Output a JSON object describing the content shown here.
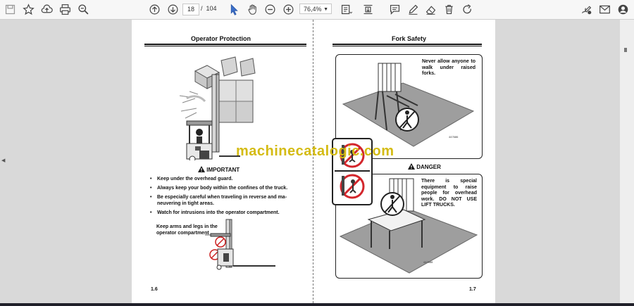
{
  "toolbar": {
    "page_current": "18",
    "page_separator": "/",
    "page_total": "104",
    "zoom_value": "76,4%",
    "icons_left": [
      "save-icon",
      "bookmark-icon",
      "upload-icon",
      "print-icon",
      "zoom-search-icon"
    ],
    "icons_mid": [
      "page-up-icon",
      "page-down-icon",
      "select-arrow-icon",
      "hand-icon",
      "zoom-out-icon",
      "zoom-in-icon"
    ],
    "icons_right": [
      "page-fit-icon",
      "scroll-icon",
      "comment-icon",
      "pen-icon",
      "eraser-icon",
      "trash-icon",
      "rotate-icon",
      "sign-icon",
      "mail-icon",
      "account-icon"
    ]
  },
  "left_page": {
    "header": "Operator Protection",
    "important_label": "IMPORTANT",
    "bullets": [
      "Keep under the overhead guard.",
      "Always keep your body within the confines of the truck.",
      "Be especially careful when traveling in reverse and ma-neuvering in tight areas.",
      "Watch for intrusions into the operator compartment."
    ],
    "caption": "Keep arms and legs in the operator compartment",
    "page_number": "1.6"
  },
  "right_page": {
    "header": "Fork Safety",
    "box1_text": "Never allow anyone to walk under raised forks.",
    "danger_label": "DANGER",
    "box2_text": "There is special equipment to raise people for overhead work. DO NOT USE LIFT TRUCKS.",
    "page_number": "1.7"
  },
  "watermark": "machinecatalogic.com",
  "colors": {
    "toolbar_bg": "#f7f7f7",
    "viewer_bg": "#d9d9d9",
    "watermark": "#d4bb14",
    "prohibition_red": "#d3262c"
  }
}
